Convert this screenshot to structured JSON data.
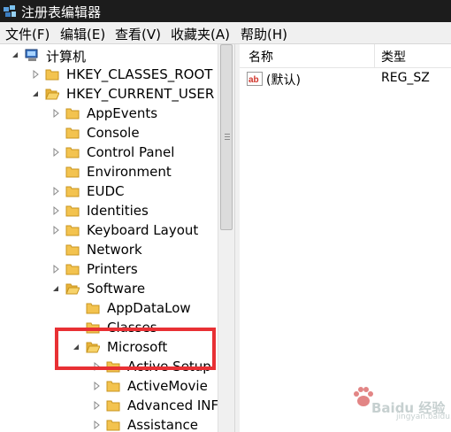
{
  "window": {
    "title": "注册表编辑器",
    "icon": "registry-editor-icon"
  },
  "menu": [
    "文件(F)",
    "编辑(E)",
    "查看(V)",
    "收藏夹(A)",
    "帮助(H)"
  ],
  "tree": {
    "root": "计算机",
    "nodes": [
      {
        "label": "HKEY_CLASSES_ROOT",
        "state": "collapsed"
      },
      {
        "label": "HKEY_CURRENT_USER",
        "state": "expanded"
      },
      {
        "label": "AppEvents",
        "state": "collapsed"
      },
      {
        "label": "Console",
        "state": "leaf"
      },
      {
        "label": "Control Panel",
        "state": "collapsed"
      },
      {
        "label": "Environment",
        "state": "leaf"
      },
      {
        "label": "EUDC",
        "state": "collapsed"
      },
      {
        "label": "Identities",
        "state": "collapsed"
      },
      {
        "label": "Keyboard Layout",
        "state": "collapsed"
      },
      {
        "label": "Network",
        "state": "leaf"
      },
      {
        "label": "Printers",
        "state": "collapsed"
      },
      {
        "label": "Software",
        "state": "expanded"
      },
      {
        "label": "AppDataLow",
        "state": "leaf"
      },
      {
        "label": "Classes",
        "state": "leaf"
      },
      {
        "label": "Microsoft",
        "state": "expanded"
      },
      {
        "label": "Active Setup",
        "state": "collapsed"
      },
      {
        "label": "ActiveMovie",
        "state": "collapsed"
      },
      {
        "label": "Advanced INF",
        "state": "collapsed"
      },
      {
        "label": "Assistance",
        "state": "collapsed"
      }
    ]
  },
  "list": {
    "columns": [
      "名称",
      "类型"
    ],
    "rows": [
      {
        "name": "(默认)",
        "type": "REG_SZ",
        "icon": "string-value-icon"
      }
    ]
  },
  "annotation": {
    "color": "#e83034",
    "target": "Microsoft"
  },
  "watermark": {
    "text": "Baidu 经验",
    "sub": "jingyan.baidu.com"
  }
}
